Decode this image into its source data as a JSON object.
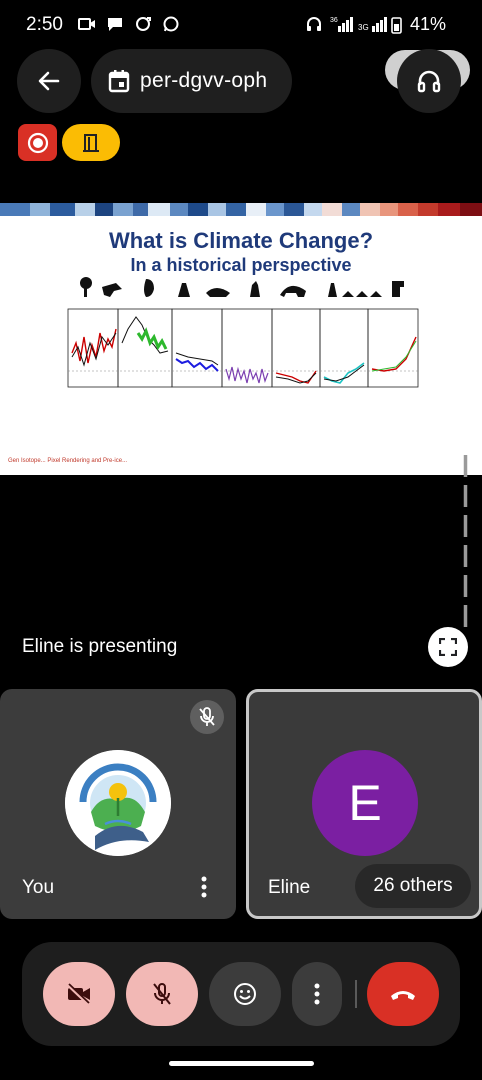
{
  "status_bar": {
    "time": "2:50",
    "signal_1": "36",
    "signal_2": "3G",
    "battery": "41%"
  },
  "meeting": {
    "code": "per-dgvv-oph"
  },
  "slide": {
    "title": "What is Climate Change?",
    "subtitle": "In a historical perspective",
    "reference": "Gen Isotope... Pixel Rendering and Pre-ice..."
  },
  "presenting_text": "Eline is presenting",
  "tiles": {
    "you": {
      "label": "You"
    },
    "eline": {
      "label": "Eline",
      "initial": "E"
    },
    "others": "26 others"
  },
  "colors": {
    "record": "#d93025",
    "door": "#fbbc04",
    "avatar_e": "#7b1fa2",
    "end_call": "#d93025",
    "muted_btn": "#f2b8b5"
  }
}
